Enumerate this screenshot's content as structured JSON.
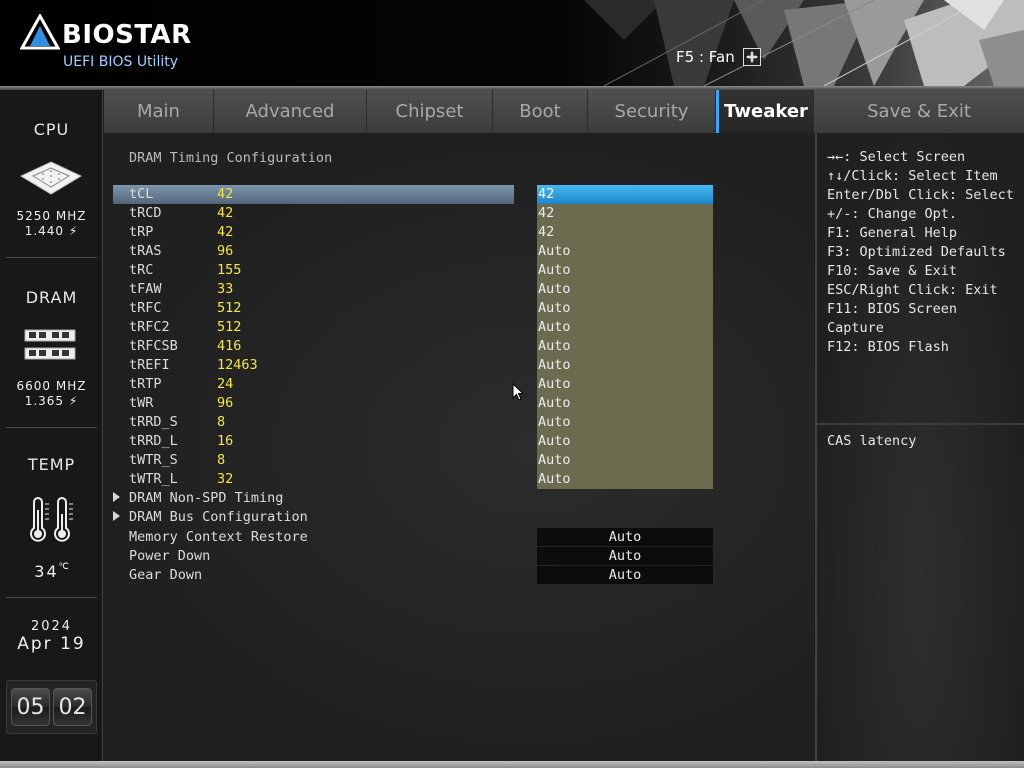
{
  "header": {
    "brand": "BIOSTAR",
    "subtitle": "UEFI BIOS Utility",
    "fan_label": "F5 : Fan"
  },
  "sidebar": {
    "cpu": {
      "title": "CPU",
      "freq": "5250 MHZ",
      "volt": "1.440"
    },
    "dram": {
      "title": "DRAM",
      "freq": "6600 MHZ",
      "volt": "1.365"
    },
    "temp": {
      "title": "TEMP",
      "value": "34"
    },
    "date": {
      "year": "2024",
      "month_day": "Apr 19"
    },
    "clock": {
      "hour": "05",
      "minute": "02"
    }
  },
  "tabs": [
    {
      "label": "Main",
      "active": false
    },
    {
      "label": "Advanced",
      "active": false
    },
    {
      "label": "Chipset",
      "active": false
    },
    {
      "label": "Boot",
      "active": false
    },
    {
      "label": "Security",
      "active": false
    },
    {
      "label": "Tweaker",
      "active": true
    },
    {
      "label": "Save & Exit",
      "active": false
    }
  ],
  "main": {
    "section_title": "DRAM Timing Configuration",
    "timings": [
      {
        "name": "tCL",
        "current": "42",
        "setting": "42",
        "selected": true
      },
      {
        "name": "tRCD",
        "current": "42",
        "setting": "42"
      },
      {
        "name": "tRP",
        "current": "42",
        "setting": "42"
      },
      {
        "name": "tRAS",
        "current": "96",
        "setting": "Auto"
      },
      {
        "name": "tRC",
        "current": "155",
        "setting": "Auto"
      },
      {
        "name": "tFAW",
        "current": "33",
        "setting": "Auto"
      },
      {
        "name": "tRFC",
        "current": "512",
        "setting": "Auto"
      },
      {
        "name": "tRFC2",
        "current": "512",
        "setting": "Auto"
      },
      {
        "name": "tRFCSB",
        "current": "416",
        "setting": "Auto"
      },
      {
        "name": "tREFI",
        "current": "12463",
        "setting": "Auto"
      },
      {
        "name": "tRTP",
        "current": "24",
        "setting": "Auto"
      },
      {
        "name": "tWR",
        "current": "96",
        "setting": "Auto"
      },
      {
        "name": "tRRD_S",
        "current": "8",
        "setting": "Auto"
      },
      {
        "name": "tRRD_L",
        "current": "16",
        "setting": "Auto"
      },
      {
        "name": "tWTR_S",
        "current": "8",
        "setting": "Auto"
      },
      {
        "name": "tWTR_L",
        "current": "32",
        "setting": "Auto"
      }
    ],
    "submenus": [
      {
        "label": "DRAM Non-SPD Timing"
      },
      {
        "label": "DRAM Bus Configuration"
      }
    ],
    "options": [
      {
        "label": "Memory Context Restore",
        "value": "Auto"
      },
      {
        "label": "Power Down",
        "value": "Auto"
      },
      {
        "label": "Gear Down",
        "value": "Auto"
      }
    ]
  },
  "help": {
    "keys": [
      "→←: Select Screen",
      "↑↓/Click: Select Item",
      "Enter/Dbl Click: Select",
      "+/-: Change Opt.",
      "F1: General Help",
      "F3: Optimized Defaults",
      "F10: Save & Exit",
      "ESC/Right Click: Exit",
      "F11: BIOS Screen",
      "Capture",
      "F12: BIOS Flash"
    ],
    "description": "CAS latency"
  },
  "colors": {
    "accent": "#3aa7ff",
    "current_value": "#f4e64a",
    "setting_box": "#6b6b4f",
    "selected_box": "#1a86c8"
  }
}
